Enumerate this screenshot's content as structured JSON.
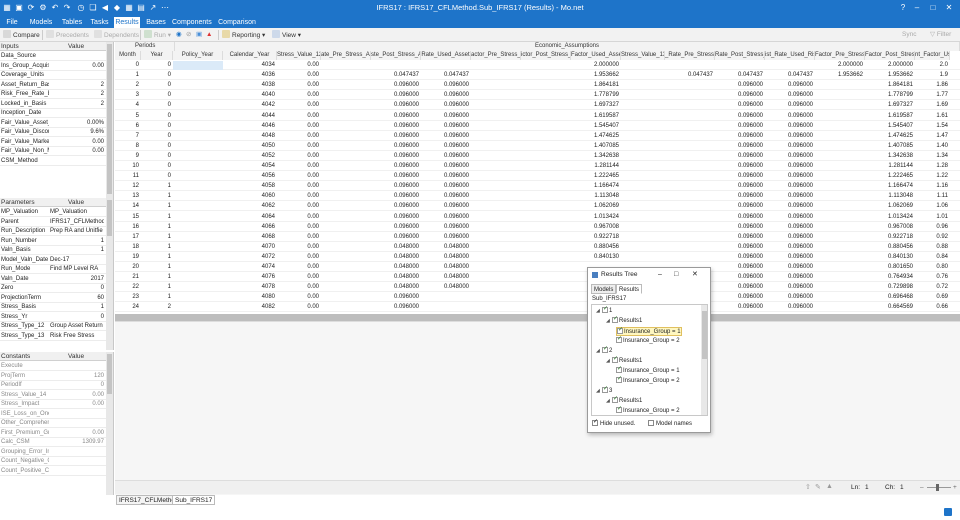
{
  "window": {
    "title": "IFRS17 : IFRS17_CFLMethod.Sub_IFRS17 (Results) - Mo.net"
  },
  "menu": {
    "items": [
      "File",
      "Models",
      "Tables",
      "Tasks",
      "Results",
      "Bases",
      "Components",
      "Comparison"
    ]
  },
  "toolbar": {
    "compare": "Compare",
    "precedents": "Precedents",
    "dependents": "Dependents",
    "run": "Run",
    "reporting": "Reporting",
    "view": "View",
    "sync": "Sync",
    "filter": "Filter"
  },
  "inputs_panel": {
    "headers": [
      "Inputs",
      "Value"
    ],
    "rows": [
      [
        "Data_Source",
        ""
      ],
      [
        "Ins_Group_Acquis",
        "0.00"
      ],
      [
        "Coverage_Units",
        ""
      ],
      [
        "Asset_Return_Basi",
        "2"
      ],
      [
        "Risk_Free_Rate_Ba",
        "2"
      ],
      [
        "Locked_in_Basis",
        "2"
      ],
      [
        "Inception_Date",
        ""
      ],
      [
        "Fair_Value_Asset_I",
        "0.00%"
      ],
      [
        "Fair_Value_Discou",
        "9.6%"
      ],
      [
        "Fair_Value_Market",
        "0.00"
      ],
      [
        "Fair_Value_Non_M",
        "0.00"
      ],
      [
        "CSM_Method",
        ""
      ]
    ]
  },
  "parameters_panel": {
    "headers": [
      "Parameters",
      "Value"
    ],
    "rows": [
      [
        "MP_Valuation",
        "MP_Valuation"
      ],
      [
        "Parent",
        "IFRS17_CFLMethod"
      ],
      [
        "Run_Description",
        "Prep RA and Unitfie"
      ],
      [
        "Run_Number",
        "1"
      ],
      [
        "Valn_Basis",
        "1"
      ],
      [
        "Model_Valn_Date",
        "Dec-17"
      ],
      [
        "Run_Mode",
        "Find MP Level RA"
      ],
      [
        "Valn_Date",
        "2017"
      ],
      [
        "Zero",
        "0"
      ],
      [
        "ProjectionTerm",
        "60"
      ],
      [
        "Stress_Basis",
        "1"
      ],
      [
        "Stress_Yr",
        "0"
      ],
      [
        "Stress_Type_12",
        "Group Asset Return"
      ],
      [
        "Stress_Type_13",
        "Risk Free Stress"
      ]
    ]
  },
  "constants_panel": {
    "headers": [
      "Constants",
      "Value"
    ],
    "rows": [
      [
        "Execute",
        ""
      ],
      [
        "ProjTerm",
        "120"
      ],
      [
        "PeriodIf",
        "0"
      ],
      [
        "Stress_Value_14",
        "0.00"
      ],
      [
        "Stress_Impact",
        "0.00"
      ],
      [
        "ISE_Loss_on_Oner",
        ""
      ],
      [
        "Other_Comprehen",
        ""
      ],
      [
        "First_Premium_Gr",
        "0.00"
      ],
      [
        "Calc_CSM",
        "1309.97"
      ],
      [
        "Grouping_Error_In",
        ""
      ],
      [
        "Count_Negative_C",
        ""
      ],
      [
        "Count_Positive_Cl",
        ""
      ]
    ]
  },
  "grid": {
    "group_headers": {
      "periods": "Periods",
      "economic": "Economic_Assumptions"
    },
    "columns": [
      "Month",
      "Year",
      "Policy_Year",
      "Calendar_Year",
      "Stress_Value_12",
      "ate_Pre_Stress_Ass",
      "ste_Post_Stress_Ass",
      "Rate_Used_Asset",
      "actor_Pre_Stress_A",
      "ictor_Post_Stress_A",
      "Factor_Used_Asse",
      "Stress_Value_13",
      "_Rate_Pre_Stress_R",
      "Rate_Post_Stress_F",
      "ist_Rate_Used_Risk",
      "Factor_Pre_Stress_",
      "Factor_Post_Stress",
      "nt_Factor_Us"
    ],
    "rows": [
      [
        "0",
        "0",
        "",
        "4034",
        "0.00",
        "",
        "",
        "",
        "",
        "",
        "2.000000",
        "",
        "",
        "",
        "",
        "2.000000",
        "2.000000",
        "2.0"
      ],
      [
        "1",
        "0",
        "",
        "4036",
        "0.00",
        "",
        "0.047437",
        "0.047437",
        "",
        "",
        "1.953662",
        "",
        "0.047437",
        "0.047437",
        "0.047437",
        "1.953662",
        "1.953662",
        "1.9"
      ],
      [
        "2",
        "0",
        "",
        "4038",
        "0.00",
        "",
        "0.096000",
        "0.096000",
        "",
        "",
        "1.864181",
        "",
        "",
        "0.096000",
        "0.096000",
        "",
        "1.864181",
        "1.86"
      ],
      [
        "3",
        "0",
        "",
        "4040",
        "0.00",
        "",
        "0.096000",
        "0.096000",
        "",
        "",
        "1.778799",
        "",
        "",
        "0.096000",
        "0.096000",
        "",
        "1.778799",
        "1.77"
      ],
      [
        "4",
        "0",
        "",
        "4042",
        "0.00",
        "",
        "0.096000",
        "0.096000",
        "",
        "",
        "1.697327",
        "",
        "",
        "0.096000",
        "0.096000",
        "",
        "1.697327",
        "1.69"
      ],
      [
        "5",
        "0",
        "",
        "4044",
        "0.00",
        "",
        "0.096000",
        "0.096000",
        "",
        "",
        "1.619587",
        "",
        "",
        "0.096000",
        "0.096000",
        "",
        "1.619587",
        "1.61"
      ],
      [
        "6",
        "0",
        "",
        "4046",
        "0.00",
        "",
        "0.096000",
        "0.096000",
        "",
        "",
        "1.545407",
        "",
        "",
        "0.096000",
        "0.096000",
        "",
        "1.545407",
        "1.54"
      ],
      [
        "7",
        "0",
        "",
        "4048",
        "0.00",
        "",
        "0.096000",
        "0.096000",
        "",
        "",
        "1.474625",
        "",
        "",
        "0.096000",
        "0.096000",
        "",
        "1.474625",
        "1.47"
      ],
      [
        "8",
        "0",
        "",
        "4050",
        "0.00",
        "",
        "0.096000",
        "0.096000",
        "",
        "",
        "1.407085",
        "",
        "",
        "0.096000",
        "0.096000",
        "",
        "1.407085",
        "1.40"
      ],
      [
        "9",
        "0",
        "",
        "4052",
        "0.00",
        "",
        "0.096000",
        "0.096000",
        "",
        "",
        "1.342638",
        "",
        "",
        "0.096000",
        "0.096000",
        "",
        "1.342638",
        "1.34"
      ],
      [
        "10",
        "0",
        "",
        "4054",
        "0.00",
        "",
        "0.096000",
        "0.096000",
        "",
        "",
        "1.281144",
        "",
        "",
        "0.096000",
        "0.096000",
        "",
        "1.281144",
        "1.28"
      ],
      [
        "11",
        "0",
        "",
        "4056",
        "0.00",
        "",
        "0.096000",
        "0.096000",
        "",
        "",
        "1.222465",
        "",
        "",
        "0.096000",
        "0.096000",
        "",
        "1.222465",
        "1.22"
      ],
      [
        "12",
        "1",
        "",
        "4058",
        "0.00",
        "",
        "0.096000",
        "0.096000",
        "",
        "",
        "1.166474",
        "",
        "",
        "0.096000",
        "0.096000",
        "",
        "1.166474",
        "1.16"
      ],
      [
        "13",
        "1",
        "",
        "4060",
        "0.00",
        "",
        "0.096000",
        "0.096000",
        "",
        "",
        "1.113048",
        "",
        "",
        "0.096000",
        "0.096000",
        "",
        "1.113048",
        "1.11"
      ],
      [
        "14",
        "1",
        "",
        "4062",
        "0.00",
        "",
        "0.096000",
        "0.096000",
        "",
        "",
        "1.062069",
        "",
        "",
        "0.096000",
        "0.096000",
        "",
        "1.062069",
        "1.06"
      ],
      [
        "15",
        "1",
        "",
        "4064",
        "0.00",
        "",
        "0.096000",
        "0.096000",
        "",
        "",
        "1.013424",
        "",
        "",
        "0.096000",
        "0.096000",
        "",
        "1.013424",
        "1.01"
      ],
      [
        "16",
        "1",
        "",
        "4066",
        "0.00",
        "",
        "0.096000",
        "0.096000",
        "",
        "",
        "0.967008",
        "",
        "",
        "0.096000",
        "0.096000",
        "",
        "0.967008",
        "0.96"
      ],
      [
        "17",
        "1",
        "",
        "4068",
        "0.00",
        "",
        "0.096000",
        "0.096000",
        "",
        "",
        "0.922718",
        "",
        "",
        "0.096000",
        "0.096000",
        "",
        "0.922718",
        "0.92"
      ],
      [
        "18",
        "1",
        "",
        "4070",
        "0.00",
        "",
        "0.048000",
        "0.048000",
        "",
        "",
        "0.880456",
        "",
        "",
        "0.096000",
        "0.096000",
        "",
        "0.880456",
        "0.88"
      ],
      [
        "19",
        "1",
        "",
        "4072",
        "0.00",
        "",
        "0.048000",
        "0.048000",
        "",
        "",
        "0.840130",
        "",
        "",
        "0.096000",
        "0.096000",
        "",
        "0.840130",
        "0.84"
      ],
      [
        "20",
        "1",
        "",
        "4074",
        "0.00",
        "",
        "0.048000",
        "0.048000",
        "",
        "",
        "",
        "",
        "",
        "0.096000",
        "0.096000",
        "",
        "0.801650",
        "0.80"
      ],
      [
        "21",
        "1",
        "",
        "4076",
        "0.00",
        "",
        "0.048000",
        "0.048000",
        "",
        "",
        "",
        "",
        "",
        "0.096000",
        "0.096000",
        "",
        "0.764934",
        "0.76"
      ],
      [
        "22",
        "1",
        "",
        "4078",
        "0.00",
        "",
        "0.048000",
        "0.048000",
        "",
        "",
        "",
        "",
        "",
        "0.096000",
        "0.096000",
        "",
        "0.729898",
        "0.72"
      ],
      [
        "23",
        "1",
        "",
        "4080",
        "0.00",
        "",
        "0.096000",
        "",
        "",
        "",
        "",
        "",
        "",
        "0.096000",
        "0.096000",
        "",
        "0.696468",
        "0.69"
      ],
      [
        "24",
        "2",
        "",
        "4082",
        "0.00",
        "",
        "0.096000",
        "",
        "",
        "",
        "",
        "",
        "",
        "0.096000",
        "0.096000",
        "",
        "0.664569",
        "0.66"
      ]
    ]
  },
  "dialog": {
    "title": "Results Tree",
    "tabs": [
      "Models",
      "Results"
    ],
    "root": "Sub_IFRS17",
    "tree": [
      {
        "label": "1",
        "level": 0
      },
      {
        "label": "Results1",
        "level": 1
      },
      {
        "label": "Insurance_Group = 1",
        "level": 2,
        "selected": true
      },
      {
        "label": "Insurance_Group = 2",
        "level": 2
      },
      {
        "label": "2",
        "level": 0
      },
      {
        "label": "Results1",
        "level": 1
      },
      {
        "label": "Insurance_Group = 1",
        "level": 2
      },
      {
        "label": "Insurance_Group = 2",
        "level": 2
      },
      {
        "label": "3",
        "level": 0
      },
      {
        "label": "Results1",
        "level": 1
      },
      {
        "label": "Insurance_Group = 2",
        "level": 2
      }
    ],
    "hide_unused": "Hide unused.",
    "model_names": "Model names"
  },
  "status": {
    "ln_label": "Ln:",
    "ln": "1",
    "ch_label": "Ch:",
    "ch": "1"
  },
  "bottom_tabs": [
    "IFRS17_CFLMethod",
    "Sub_IFRS17"
  ],
  "colors": {
    "brand": "#1e74c9",
    "selected_cell": "#dbeaf8",
    "tree_selected": "#fff7c0"
  }
}
